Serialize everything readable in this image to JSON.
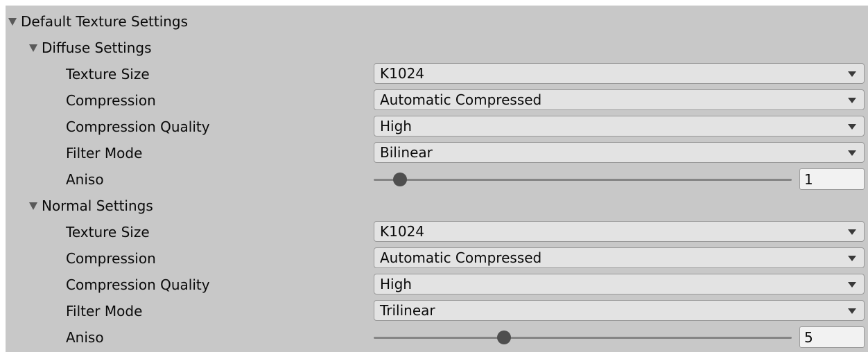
{
  "default_settings": {
    "title": "Default Texture Settings",
    "expanded": true,
    "diffuse": {
      "title": "Diffuse Settings",
      "expanded": true,
      "texture_size": {
        "label": "Texture Size",
        "value": "K1024"
      },
      "compression": {
        "label": "Compression",
        "value": "Automatic Compressed"
      },
      "compression_quality": {
        "label": "Compression Quality",
        "value": "High"
      },
      "filter_mode": {
        "label": "Filter Mode",
        "value": "Bilinear"
      },
      "aniso": {
        "label": "Aniso",
        "value": "1",
        "slider_fraction": 0.0625
      }
    },
    "normal": {
      "title": "Normal Settings",
      "expanded": true,
      "texture_size": {
        "label": "Texture Size",
        "value": "K1024"
      },
      "compression": {
        "label": "Compression",
        "value": "Automatic Compressed"
      },
      "compression_quality": {
        "label": "Compression Quality",
        "value": "High"
      },
      "filter_mode": {
        "label": "Filter Mode",
        "value": "Trilinear"
      },
      "aniso": {
        "label": "Aniso",
        "value": "5",
        "slider_fraction": 0.3125
      }
    }
  },
  "icons": {
    "foldout": "triangle-down-icon",
    "dropdown": "dropdown-arrow-icon"
  },
  "colors": {
    "panel_bg": "#c8c8c8",
    "field_bg": "#e3e3e3",
    "thumb": "#4f4f4f",
    "track": "#858585"
  }
}
